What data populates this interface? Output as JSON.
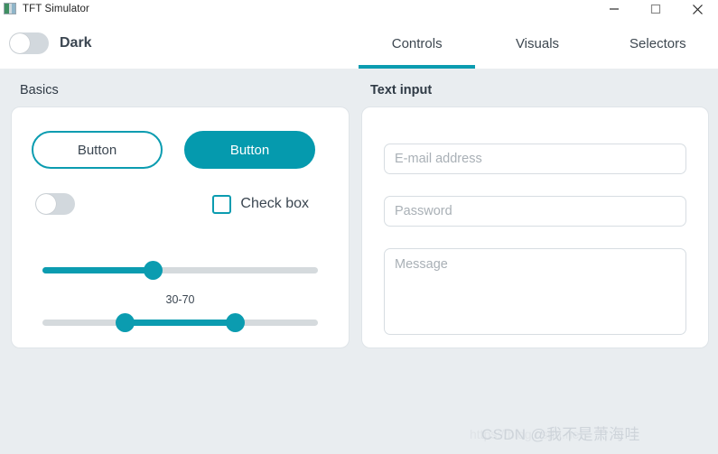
{
  "window": {
    "title": "TFT Simulator",
    "icon_name": "app-image-icon",
    "controls": {
      "minimize": "minimize-icon",
      "maximize": "maximize-icon",
      "close": "close-icon"
    }
  },
  "header": {
    "dark_label": "Dark",
    "dark_toggle_state": "off"
  },
  "tabs": [
    {
      "label": "Controls",
      "active": true
    },
    {
      "label": "Visuals",
      "active": false
    },
    {
      "label": "Selectors",
      "active": false
    }
  ],
  "basics": {
    "section_title": "Basics",
    "button_outline_label": "Button",
    "button_filled_label": "Button",
    "switch_state": "off",
    "checkbox_label": "Check box",
    "checkbox_state": "unchecked",
    "slider_value": 40,
    "range_label": "30-70",
    "range_low": 30,
    "range_high": 70
  },
  "text_input": {
    "section_title": "Text input",
    "email_placeholder": "E-mail address",
    "email_value": "",
    "password_placeholder": "Password",
    "password_value": "",
    "message_placeholder": "Message",
    "message_value": ""
  },
  "watermark": {
    "url_text": "https://blog.csdn.net",
    "main_text": "CSDN @我不是萧海哇"
  },
  "colors": {
    "accent": "#0b9cb0",
    "accent_fill": "#059aae",
    "content_background": "#e9edf0",
    "card_background": "#ffffff",
    "track": "#d5dadd",
    "text": "#3b4651"
  }
}
